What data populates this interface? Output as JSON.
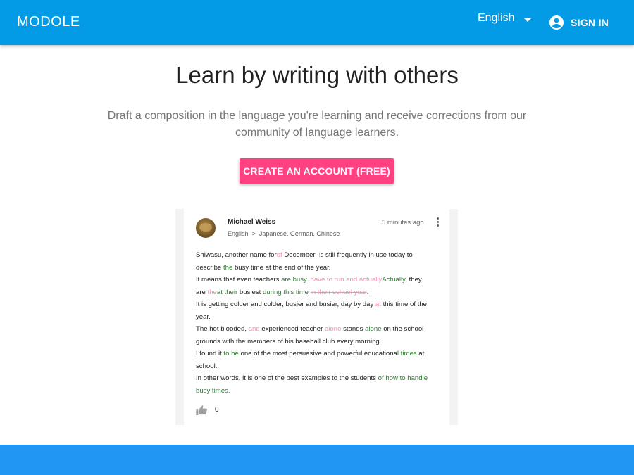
{
  "appbar": {
    "brand": "MODOLE",
    "language": "English",
    "signin_label": "SIGN IN",
    "color": "#039be5"
  },
  "hero": {
    "title": "Learn by writing with others",
    "subtitle_line1": "Draft a composition in the language you're learning and receive corrections from our",
    "subtitle_line2": "community of language learners.",
    "cta_label": "CREATE AN ACCOUNT (FREE)",
    "cta_color": "#ff4081"
  },
  "sample": {
    "author": "Michael Weiss",
    "native_lang": "English",
    "arrow": ">",
    "target_langs": "Japanese, German, Chinese",
    "time": "5 minutes ago",
    "likes": "0",
    "lines": [
      [
        {
          "t": "Shiwasu, another name for"
        },
        {
          "t": "of",
          "c": "del"
        },
        {
          "t": " December, "
        },
        {
          "t": "i",
          "c": "del"
        },
        {
          "t": "s still frequently in use today to"
        }
      ],
      [
        {
          "t": "describe "
        },
        {
          "t": "the",
          "c": "add"
        },
        {
          "t": " busy time at the end of the year."
        }
      ],
      [
        {
          "t": "It means that even teachers "
        },
        {
          "t": "are busy.",
          "c": "add"
        },
        {
          "t": "  "
        },
        {
          "t": "have to run and actually",
          "c": "del"
        },
        {
          "t": "Actually,",
          "c": "add"
        },
        {
          "t": " they"
        }
      ],
      [
        {
          "t": "are "
        },
        {
          "t": "the",
          "c": "del"
        },
        {
          "t": "at their",
          "c": "add"
        },
        {
          "t": " busiest "
        },
        {
          "t": "during this time",
          "c": "add"
        },
        {
          "t": " "
        },
        {
          "t": "in their school year",
          "c": "del strike"
        },
        {
          "t": "."
        }
      ],
      [
        {
          "t": "It is getting colder and colder, busier and busier, day by day "
        },
        {
          "t": "at",
          "c": "del"
        },
        {
          "t": " this time of the"
        }
      ],
      [
        {
          "t": "year."
        }
      ],
      [
        {
          "t": "The hot blooded, "
        },
        {
          "t": "and",
          "c": "del"
        },
        {
          "t": " experienced teacher "
        },
        {
          "t": "alone",
          "c": "del"
        },
        {
          "t": " stands "
        },
        {
          "t": "alone",
          "c": "add"
        },
        {
          "t": " on the school"
        }
      ],
      [
        {
          "t": "grounds with the members of his baseball club every morning."
        }
      ],
      [
        {
          "t": "I found it "
        },
        {
          "t": "to be",
          "c": "add"
        },
        {
          "t": " one of the most persuasive and powerful educationa"
        },
        {
          "t": "l times",
          "c": "add"
        },
        {
          "t": " at"
        }
      ],
      [
        {
          "t": "school."
        }
      ],
      [
        {
          "t": "In other words, it is one of the best examples to the students "
        },
        {
          "t": "of how to handle",
          "c": "add"
        }
      ],
      [
        {
          "t": "busy times.",
          "c": "add"
        }
      ]
    ]
  },
  "colors": {
    "correction_add": "#2e7d32",
    "correction_delete": "#f48fb1",
    "footer_band": "#2196f3"
  }
}
